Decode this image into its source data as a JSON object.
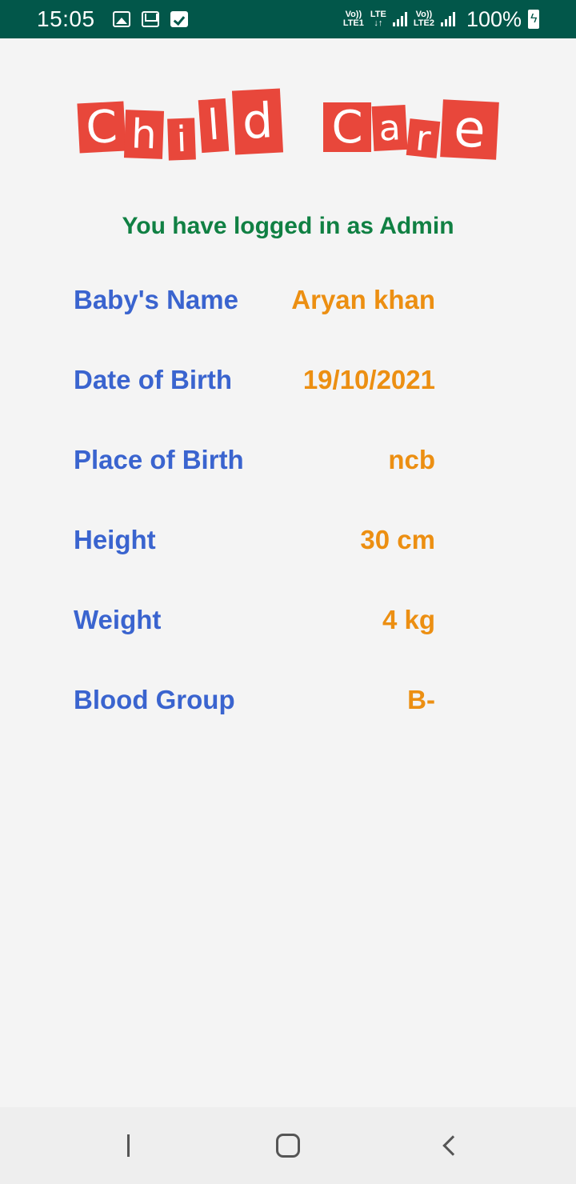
{
  "status_bar": {
    "time": "15:05",
    "icons": [
      "image-icon",
      "mail-icon",
      "checkbox-icon"
    ],
    "sim1_label_top": "Vo))",
    "sim1_label_bottom": "LTE1",
    "lte_label_top": "LTE",
    "lte_label_bottom": "↓↑",
    "sim2_label_top": "Vo))",
    "sim2_label_bottom": "LTE2",
    "battery": "100%"
  },
  "logo": {
    "letters": [
      "C",
      "h",
      "i",
      "l",
      "d",
      "C",
      "a",
      "r",
      "e"
    ],
    "color": "#e8473b"
  },
  "admin_message": "You have logged in as Admin",
  "details": [
    {
      "label": "Baby's Name",
      "value": "Aryan khan"
    },
    {
      "label": "Date of Birth",
      "value": "19/10/2021"
    },
    {
      "label": "Place of Birth",
      "value": "ncb"
    },
    {
      "label": "Height",
      "value": "30 cm"
    },
    {
      "label": "Weight",
      "value": "4 kg"
    },
    {
      "label": "Blood Group",
      "value": "B-"
    }
  ],
  "colors": {
    "status_bar": "#02574a",
    "admin_message": "#108043",
    "label": "#3a64cf",
    "value": "#ec8f12"
  },
  "nav_bar": {
    "icons": [
      "recent-apps-icon",
      "home-icon",
      "back-icon"
    ]
  }
}
